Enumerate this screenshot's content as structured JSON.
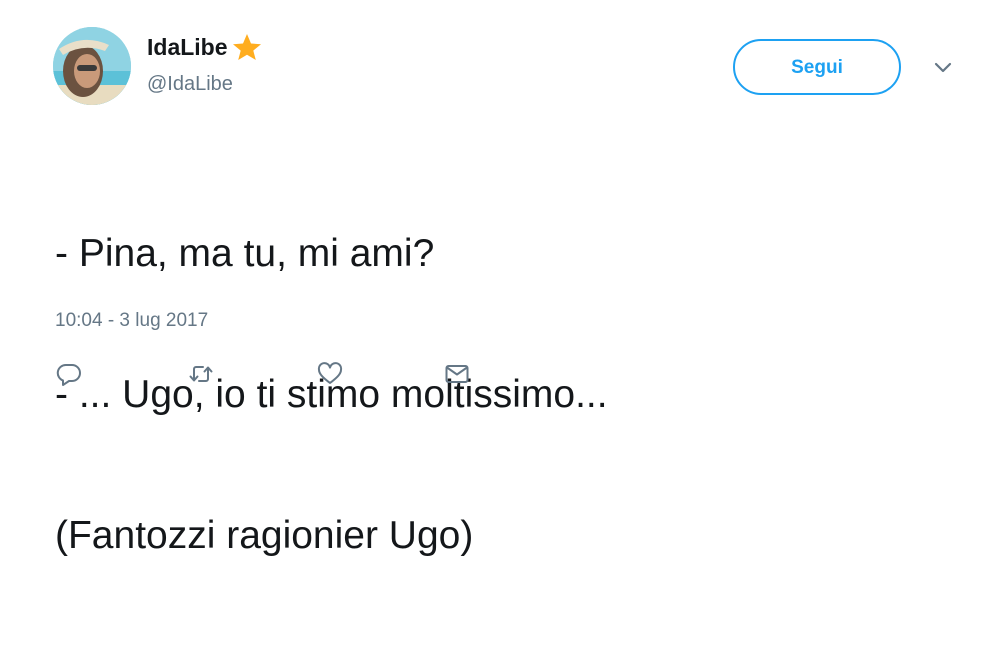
{
  "user": {
    "display_name": "IdaLibe",
    "handle": "@IdaLibe",
    "badge_icon": "star-icon",
    "avatar_icon": "profile-photo"
  },
  "follow_button": {
    "label": "Segui",
    "color": "#1da1f2"
  },
  "menu": {
    "icon": "chevron-down-icon"
  },
  "tweet": {
    "lines": [
      "- Pina, ma tu, mi ami?",
      "- ... Ugo, io ti stimo moltissimo...",
      "(Fantozzi ragionier Ugo)"
    ],
    "timestamp": "10:04 - 3 lug 2017"
  },
  "actions": [
    {
      "icon": "reply-icon"
    },
    {
      "icon": "retweet-icon"
    },
    {
      "icon": "like-icon"
    },
    {
      "icon": "direct-message-icon"
    }
  ],
  "colors": {
    "text_primary": "#14171a",
    "text_secondary": "#657786",
    "accent": "#1da1f2",
    "star": "#ffad1f"
  }
}
